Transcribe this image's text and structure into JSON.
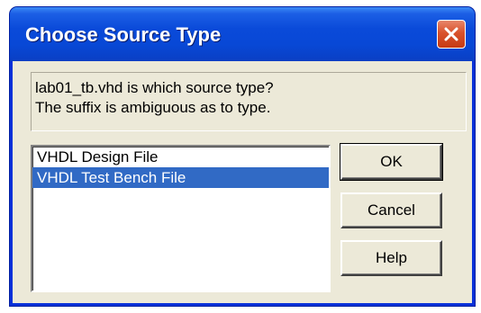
{
  "window": {
    "title": "Choose Source Type",
    "close_icon": "close-icon"
  },
  "message": {
    "line1": "lab01_tb.vhd is which source type?",
    "line2": "The suffix is ambiguous as to type."
  },
  "source_types": {
    "items": [
      {
        "label": "VHDL Design File",
        "selected": false
      },
      {
        "label": "VHDL Test Bench File",
        "selected": true
      }
    ]
  },
  "buttons": {
    "ok_label": "OK",
    "cancel_label": "Cancel",
    "help_label": "Help"
  },
  "colors": {
    "titlebar": "#0a4ad9",
    "selection": "#316ac5",
    "dialog_bg": "#ece9d8",
    "close_button": "#d9522c"
  }
}
